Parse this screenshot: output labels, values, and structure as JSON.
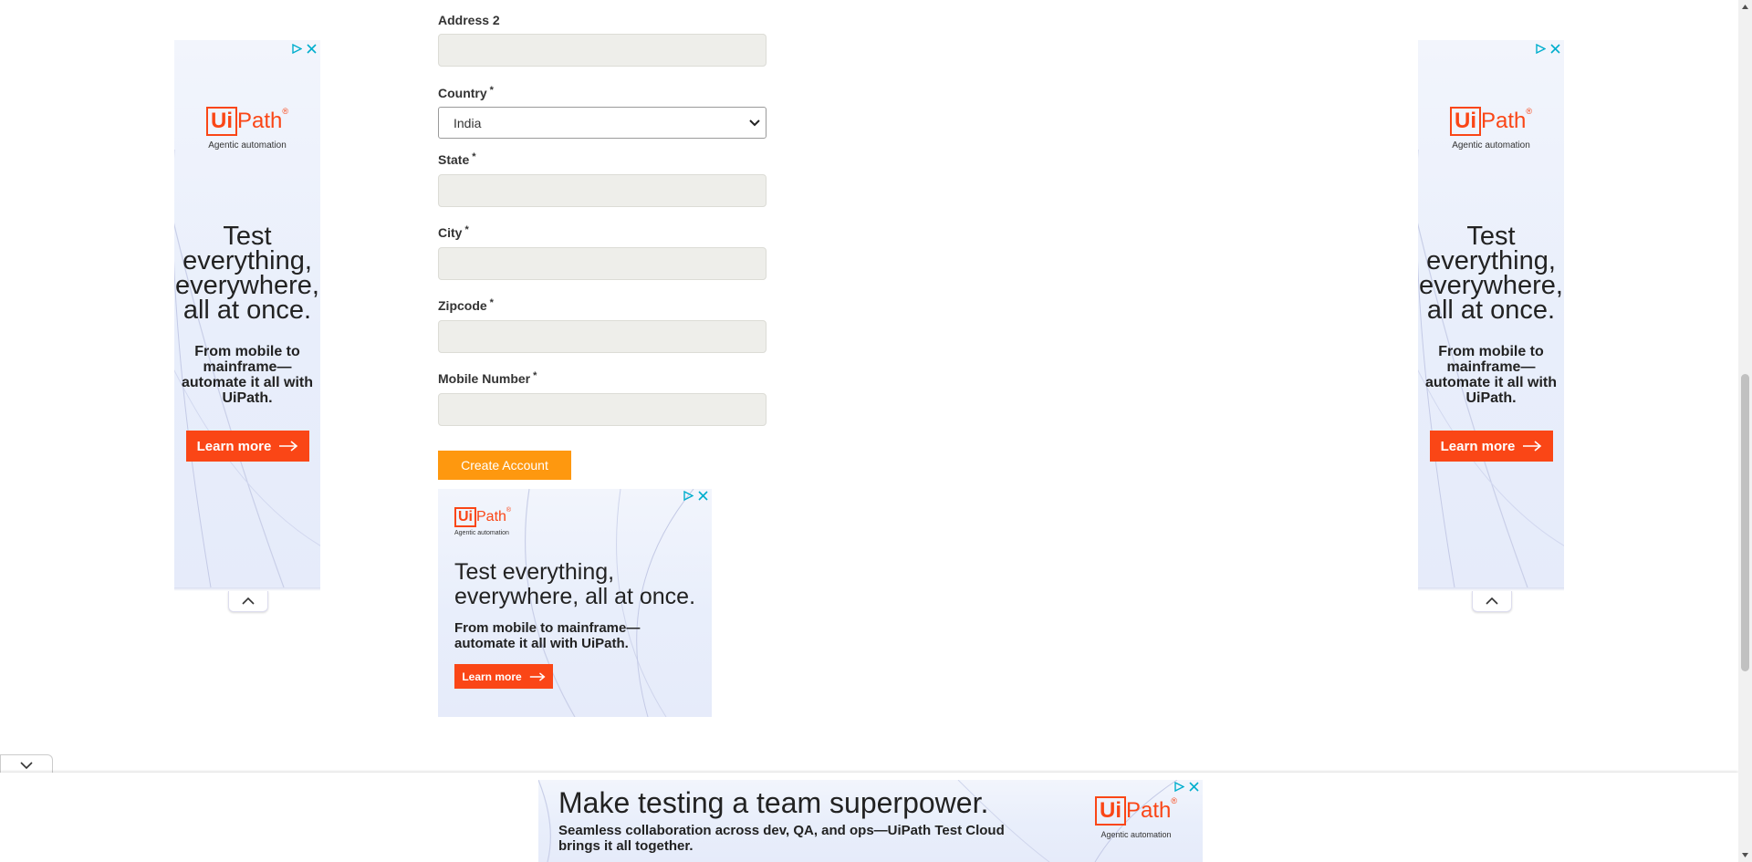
{
  "form": {
    "address2": {
      "label": "Address 2",
      "value": ""
    },
    "country": {
      "label": "Country",
      "required_mark": "*",
      "selected": "India"
    },
    "state": {
      "label": "State",
      "required_mark": "*",
      "value": ""
    },
    "city": {
      "label": "City",
      "required_mark": "*",
      "value": ""
    },
    "zipcode": {
      "label": "Zipcode",
      "required_mark": "*",
      "value": ""
    },
    "mobile": {
      "label": "Mobile Number",
      "required_mark": "*",
      "value": ""
    },
    "create_button": "Create Account"
  },
  "ads": {
    "brand_box": "Ui",
    "brand_rest": "Path",
    "brand_mark": "®",
    "tagline": "Agentic automation",
    "side": {
      "headline": "Test everything, everywhere, all at once.",
      "subline": "From mobile to mainframe— automate it all with UiPath.",
      "cta": "Learn more"
    },
    "inline": {
      "headline": "Test everything, everywhere, all at once.",
      "subline": "From mobile to mainframe— automate it all with UiPath.",
      "cta": "Learn more"
    },
    "banner": {
      "headline": "Make testing a team superpower.",
      "subline": "Seamless collaboration across dev, QA, and ops—UiPath Test Cloud brings it all together."
    }
  },
  "colors": {
    "accent_orange": "#fe980f",
    "brand_orange": "#fa4616",
    "input_bg": "#eeeeea",
    "ad_choices": "#00aecd"
  },
  "icons": [
    "ad-choices-icon",
    "close-icon",
    "chevron-up-icon",
    "chevron-down-icon",
    "arrow-right-icon"
  ]
}
